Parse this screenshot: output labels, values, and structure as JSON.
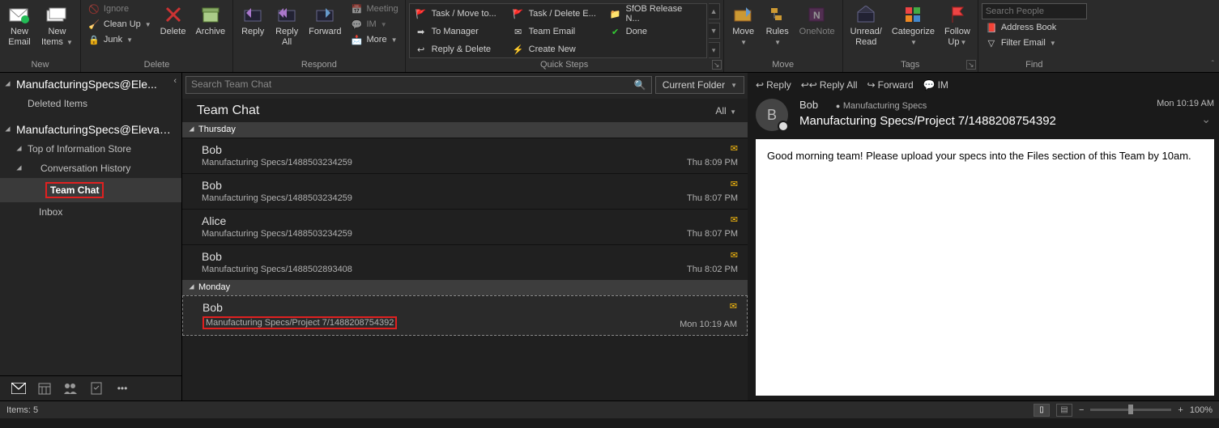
{
  "ribbon": {
    "new": {
      "label": "New",
      "new_email": "New\nEmail",
      "new_items": "New\nItems"
    },
    "delete": {
      "label": "Delete",
      "ignore": "Ignore",
      "clean_up": "Clean Up",
      "junk": "Junk",
      "delete": "Delete",
      "archive": "Archive"
    },
    "respond": {
      "label": "Respond",
      "reply": "Reply",
      "reply_all": "Reply\nAll",
      "forward": "Forward",
      "meeting": "Meeting",
      "im": "IM",
      "more": "More"
    },
    "quick_steps": {
      "label": "Quick Steps",
      "items": [
        "Task / Move to...",
        "Task / Delete E...",
        "SfOB Release N...",
        "To Manager",
        "Team Email",
        "Done",
        "Reply & Delete",
        "Create New"
      ]
    },
    "move": {
      "label": "Move",
      "move": "Move",
      "rules": "Rules",
      "onenote": "OneNote"
    },
    "tags": {
      "label": "Tags",
      "unread": "Unread/\nRead",
      "categorize": "Categorize",
      "follow_up": "Follow\nUp"
    },
    "find": {
      "label": "Find",
      "search_placeholder": "Search People",
      "address_book": "Address Book",
      "filter_email": "Filter Email"
    }
  },
  "folder_pane": {
    "account1": "ManufacturingSpecs@Ele...",
    "deleted": "Deleted Items",
    "account2": "ManufacturingSpecs@ElevatedR...",
    "top_store": "Top of Information Store",
    "conv_hist": "Conversation History",
    "team_chat": "Team Chat",
    "inbox": "Inbox"
  },
  "list": {
    "search_placeholder": "Search Team Chat",
    "scope": "Current Folder",
    "folder_name": "Team Chat",
    "filter": "All",
    "groups": [
      {
        "name": "Thursday",
        "messages": [
          {
            "from": "Bob",
            "subject": "Manufacturing Specs/1488503234259",
            "time": "Thu 8:09 PM"
          },
          {
            "from": "Bob",
            "subject": "Manufacturing Specs/1488503234259",
            "time": "Thu 8:07 PM"
          },
          {
            "from": "Alice",
            "subject": "Manufacturing Specs/1488503234259",
            "time": "Thu 8:07 PM"
          },
          {
            "from": "Bob",
            "subject": "Manufacturing Specs/1488502893408",
            "time": "Thu 8:02 PM"
          }
        ]
      },
      {
        "name": "Monday",
        "messages": [
          {
            "from": "Bob",
            "subject": "Manufacturing Specs/Project 7/1488208754392",
            "time": "Mon 10:19 AM",
            "selected": true,
            "red": true
          }
        ]
      }
    ]
  },
  "reading": {
    "actions": {
      "reply": "Reply",
      "reply_all": "Reply All",
      "forward": "Forward",
      "im": "IM"
    },
    "from": "Bob",
    "to_label": "Manufacturing Specs",
    "subject": "Manufacturing Specs/Project 7/1488208754392",
    "time": "Mon 10:19 AM",
    "avatar_initial": "B",
    "body": "Good morning team! Please upload your specs into the Files section of this Team by 10am."
  },
  "status": {
    "items": "Items: 5",
    "zoom": "100%"
  }
}
